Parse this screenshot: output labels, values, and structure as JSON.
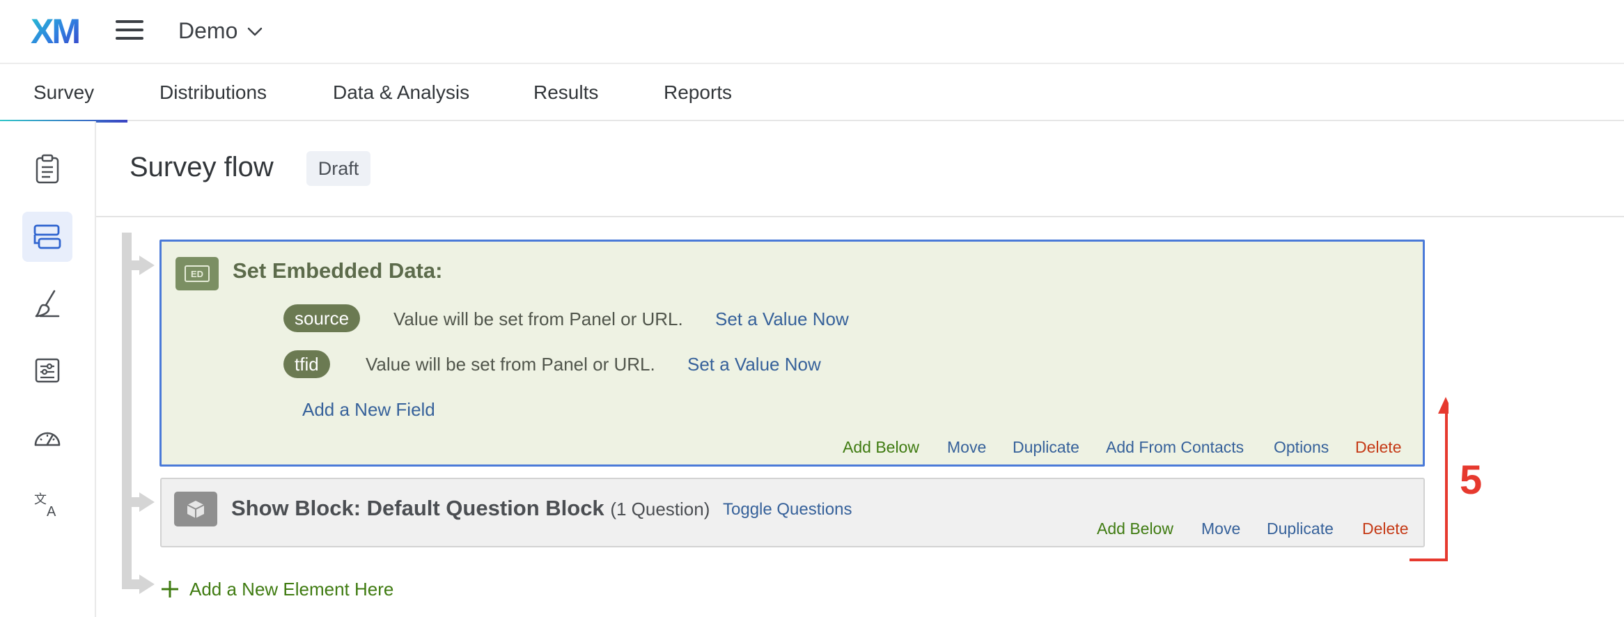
{
  "header": {
    "logo_text": "XM",
    "project_name": "Demo"
  },
  "tabs": [
    {
      "label": "Survey",
      "active": true
    },
    {
      "label": "Distributions",
      "active": false
    },
    {
      "label": "Data & Analysis",
      "active": false
    },
    {
      "label": "Results",
      "active": false
    },
    {
      "label": "Reports",
      "active": false
    }
  ],
  "rail": {
    "items": [
      {
        "icon": "clipboard-icon",
        "active": false
      },
      {
        "icon": "survey-flow-icon",
        "active": true
      },
      {
        "icon": "paintbrush-icon",
        "active": false
      },
      {
        "icon": "survey-options-icon",
        "active": false
      },
      {
        "icon": "gauge-icon",
        "active": false
      },
      {
        "icon": "translate-icon",
        "active": false
      }
    ]
  },
  "page": {
    "title": "Survey flow",
    "status_badge": "Draft"
  },
  "embedded_data": {
    "icon_label": "ED",
    "title": "Set Embedded Data:",
    "fields": [
      {
        "name": "source",
        "description": "Value will be set from Panel or URL.",
        "action": "Set a Value Now"
      },
      {
        "name": "tfid",
        "description": "Value will be set from Panel or URL.",
        "action": "Set a Value Now"
      }
    ],
    "add_field": "Add a New Field",
    "actions": {
      "add_below": "Add Below",
      "move": "Move",
      "duplicate": "Duplicate",
      "add_from_contacts": "Add From Contacts",
      "options": "Options",
      "delete": "Delete"
    }
  },
  "show_block": {
    "title": "Show Block: Default Question Block",
    "count": "(1 Question)",
    "toggle": "Toggle Questions",
    "actions": {
      "add_below": "Add Below",
      "move": "Move",
      "duplicate": "Duplicate",
      "delete": "Delete"
    }
  },
  "add_element": "Add a New Element Here",
  "annotation": {
    "number": "5",
    "color": "#e6392e"
  },
  "colors": {
    "accent_blue": "#4a7ad8",
    "link_blue": "#36619a",
    "action_green": "#3f7b11",
    "delete_red": "#c53a16",
    "embedded_bg": "#eef2e3"
  }
}
